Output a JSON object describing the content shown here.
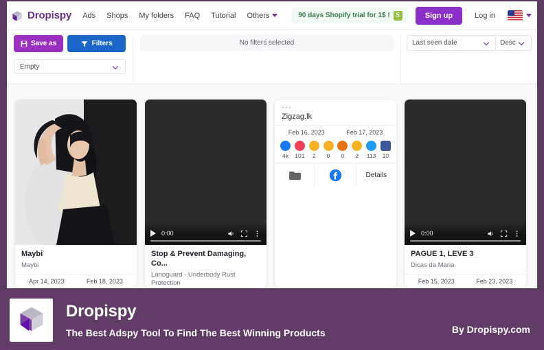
{
  "nav": {
    "brand": "Dropispy",
    "brand_logo_icon": "cube-logo-icon",
    "links": [
      {
        "label": "Ads",
        "name": "nav-link-ads"
      },
      {
        "label": "Shops",
        "name": "nav-link-shops"
      },
      {
        "label": "My folders",
        "name": "nav-link-my-folders"
      },
      {
        "label": "FAQ",
        "name": "nav-link-faq"
      },
      {
        "label": "Tutorial",
        "name": "nav-link-tutorial"
      },
      {
        "label": "Others",
        "name": "nav-link-others",
        "caret": true
      }
    ],
    "promo": "90 days Shopify trial for 1$ !",
    "promo_icon": "shopify-bag-icon",
    "signup": "Sign up",
    "login": "Log in",
    "flag_icon": "us-flag-icon",
    "flag_caret_icon": "chevron-down-icon"
  },
  "filterbar": {
    "save_as": "Save as",
    "save_icon": "floppy-disk-icon",
    "filters": "Filters",
    "filters_icon": "funnel-icon",
    "saved_filter_value": "Empty",
    "no_filters": "No filters selected",
    "sort_value": "Last seen date",
    "direction_value": "Desc"
  },
  "cards": [
    {
      "name": "card-maybi",
      "media_type": "photo",
      "title": "Maybi",
      "subtitle": "Maybi",
      "date_first": "Apr 14, 2023",
      "date_last": "Feb 18, 2023"
    },
    {
      "name": "card-lanoguard",
      "media_type": "video",
      "video_time": "0:00",
      "title": "Stop & Prevent Damaging, Co...",
      "subtitle": "Lanoguard - Underbody Rust Protection"
    },
    {
      "name": "card-zigzag",
      "media_type": "post",
      "menu_dots": "···",
      "page_name": "Zigzag.lk",
      "date_first": "Feb 16, 2023",
      "date_last": "Feb 17, 2023",
      "reactions": [
        {
          "icon": "like-icon",
          "count": "4k",
          "color": "#1877f2"
        },
        {
          "icon": "love-icon",
          "count": "101",
          "color": "#f33e58"
        },
        {
          "icon": "haha-icon",
          "count": "2",
          "color": "#f7b125"
        },
        {
          "icon": "sad-icon",
          "count": "0",
          "color": "#f7b125"
        },
        {
          "icon": "angry-icon",
          "count": "0",
          "color": "#e9710f"
        },
        {
          "icon": "wow-icon",
          "count": "2",
          "color": "#f7b125"
        },
        {
          "icon": "share-icon",
          "count": "113",
          "color": "#1d9bf0"
        },
        {
          "icon": "comment-icon",
          "count": "10",
          "color": "#3b5998"
        }
      ],
      "action_folder_icon": "folder-icon",
      "action_facebook_icon": "facebook-icon",
      "action_details": "Details"
    },
    {
      "name": "card-pague",
      "media_type": "video",
      "video_time": "0:00",
      "title": "PAGUE 1, LEVE 3",
      "subtitle": "Dicas da Maria",
      "date_first": "Feb 15, 2023",
      "date_last": "Feb 23, 2023"
    }
  ],
  "banner": {
    "logo_icon": "cube-logo-icon",
    "title": "Dropispy",
    "subtitle": "The Best Adspy Tool To Find The Best Winning Products",
    "by": "By Dropispy.com"
  },
  "colors": {
    "brand_purple": "#6b2f8e",
    "signup_purple": "#8b2fc9",
    "filters_blue": "#1a66c9",
    "banner_purple": "#613c66",
    "frame_purple": "#5b3c60"
  }
}
